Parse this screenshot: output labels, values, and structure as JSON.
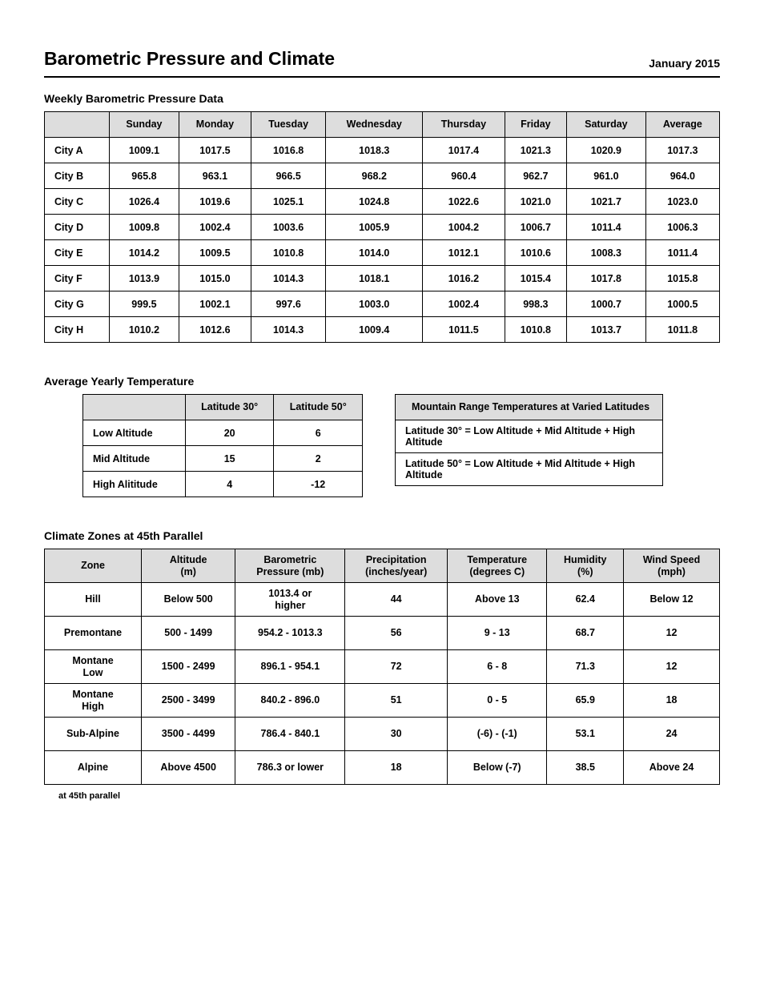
{
  "header": {
    "title": "Barometric Pressure and Climate",
    "date": "January 2015"
  },
  "section1": {
    "title": "Weekly Barometric Pressure Data",
    "columns": [
      "",
      "Sunday",
      "Monday",
      "Tuesday",
      "Wednesday",
      "Thursday",
      "Friday",
      "Saturday",
      "Average"
    ],
    "rows": [
      {
        "label": "City A",
        "values": [
          "1009.1",
          "1017.5",
          "1016.8",
          "1018.3",
          "1017.4",
          "1021.3",
          "1020.9",
          "1017.3"
        ]
      },
      {
        "label": "City B",
        "values": [
          "965.8",
          "963.1",
          "966.5",
          "968.2",
          "960.4",
          "962.7",
          "961.0",
          "964.0"
        ]
      },
      {
        "label": "City C",
        "values": [
          "1026.4",
          "1019.6",
          "1025.1",
          "1024.8",
          "1022.6",
          "1021.0",
          "1021.7",
          "1023.0"
        ]
      },
      {
        "label": "City D",
        "values": [
          "1009.8",
          "1002.4",
          "1003.6",
          "1005.9",
          "1004.2",
          "1006.7",
          "1011.4",
          "1006.3"
        ]
      },
      {
        "label": "City E",
        "values": [
          "1014.2",
          "1009.5",
          "1010.8",
          "1014.0",
          "1012.1",
          "1010.6",
          "1008.3",
          "1011.4"
        ]
      },
      {
        "label": "City F",
        "values": [
          "1013.9",
          "1015.0",
          "1014.3",
          "1018.1",
          "1016.2",
          "1015.4",
          "1017.8",
          "1015.8"
        ]
      },
      {
        "label": "City G",
        "values": [
          "999.5",
          "1002.1",
          "997.6",
          "1003.0",
          "1002.4",
          "998.3",
          "1000.7",
          "1000.5"
        ]
      },
      {
        "label": "City H",
        "values": [
          "1010.2",
          "1012.6",
          "1014.3",
          "1009.4",
          "1011.5",
          "1010.8",
          "1013.7",
          "1011.8"
        ]
      }
    ]
  },
  "section2": {
    "title": "Average Yearly Temperature",
    "tableB": {
      "columns": [
        "",
        "Latitude 30°",
        "Latitude 50°"
      ],
      "rows": [
        {
          "label": "Low Altitude",
          "values": [
            "20",
            "6"
          ]
        },
        {
          "label": "Mid Altitude",
          "values": [
            "15",
            "2"
          ]
        },
        {
          "label": "High Alititude",
          "values": [
            "4",
            "-12"
          ]
        }
      ]
    },
    "tableC": {
      "header": "Mountain Range Temperatures at Varied Latitudes",
      "rows": [
        "Latitude 30° = Low Altitude + Mid Altitude + High Altitude",
        "Latitude 50° = Low Altitude + Mid Altitude + High Altitude"
      ]
    }
  },
  "section3": {
    "title": "Climate Zones at 45th Parallel",
    "columns": [
      "Zone",
      "Altitude\n(m)",
      "Barometric\nPressure (mb)",
      "Precipitation\n(inches/year)",
      "Temperature\n(degrees C)",
      "Humidity\n(%)",
      "Wind Speed\n(mph)"
    ],
    "rows": [
      {
        "zone": "Hill",
        "values": [
          "Below 500",
          "1013.4 or\nhigher",
          "44",
          "Above 13",
          "62.4",
          "Below 12"
        ]
      },
      {
        "zone": "Premontane",
        "values": [
          "500 - 1499",
          "954.2 - 1013.3",
          "56",
          "9 - 13",
          "68.7",
          "12"
        ]
      },
      {
        "zone": "Montane\nLow",
        "values": [
          "1500 - 2499",
          "896.1 - 954.1",
          "72",
          "6 - 8",
          "71.3",
          "12"
        ]
      },
      {
        "zone": "Montane\nHigh",
        "values": [
          "2500 - 3499",
          "840.2 - 896.0",
          "51",
          "0 - 5",
          "65.9",
          "18"
        ]
      },
      {
        "zone": "Sub-Alpine",
        "values": [
          "3500 - 4499",
          "786.4 - 840.1",
          "30",
          "(-6) - (-1)",
          "53.1",
          "24"
        ]
      },
      {
        "zone": "Alpine",
        "values": [
          "Above 4500",
          "786.3 or lower",
          "18",
          "Below (-7)",
          "38.5",
          "Above 24"
        ]
      }
    ],
    "at_line": "at 45th parallel"
  }
}
